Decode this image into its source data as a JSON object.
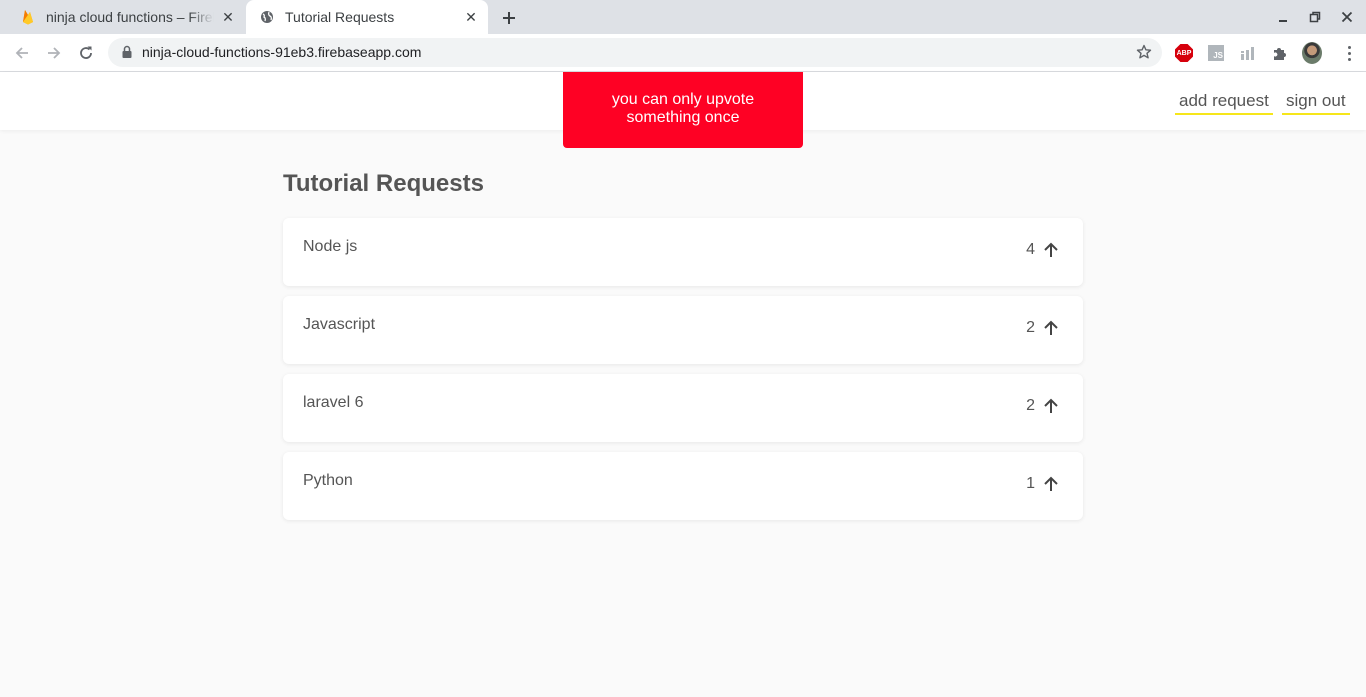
{
  "browser": {
    "tabs": [
      {
        "title": "ninja cloud functions – Firebase console",
        "icon": "firebase-flame-icon",
        "active": false
      },
      {
        "title": "Tutorial Requests",
        "icon": "globe-icon",
        "active": true
      }
    ],
    "url": "ninja-cloud-functions-91eb3.firebaseapp.com",
    "extensions": [
      "adblock-plus-icon",
      "js-extension-icon",
      "analytics-extension-icon",
      "puzzle-piece-icon",
      "profile-avatar"
    ]
  },
  "header": {
    "links": [
      {
        "label": "add request"
      },
      {
        "label": "sign out"
      }
    ],
    "accent_color": "#f6e61a"
  },
  "notice": {
    "text": "you can only upvote something once",
    "color": "#fe0124"
  },
  "main": {
    "title": "Tutorial Requests",
    "requests": [
      {
        "text": "Node js",
        "votes": "4"
      },
      {
        "text": "Javascript",
        "votes": "2"
      },
      {
        "text": "laravel 6",
        "votes": "2"
      },
      {
        "text": "Python",
        "votes": "1"
      }
    ]
  }
}
